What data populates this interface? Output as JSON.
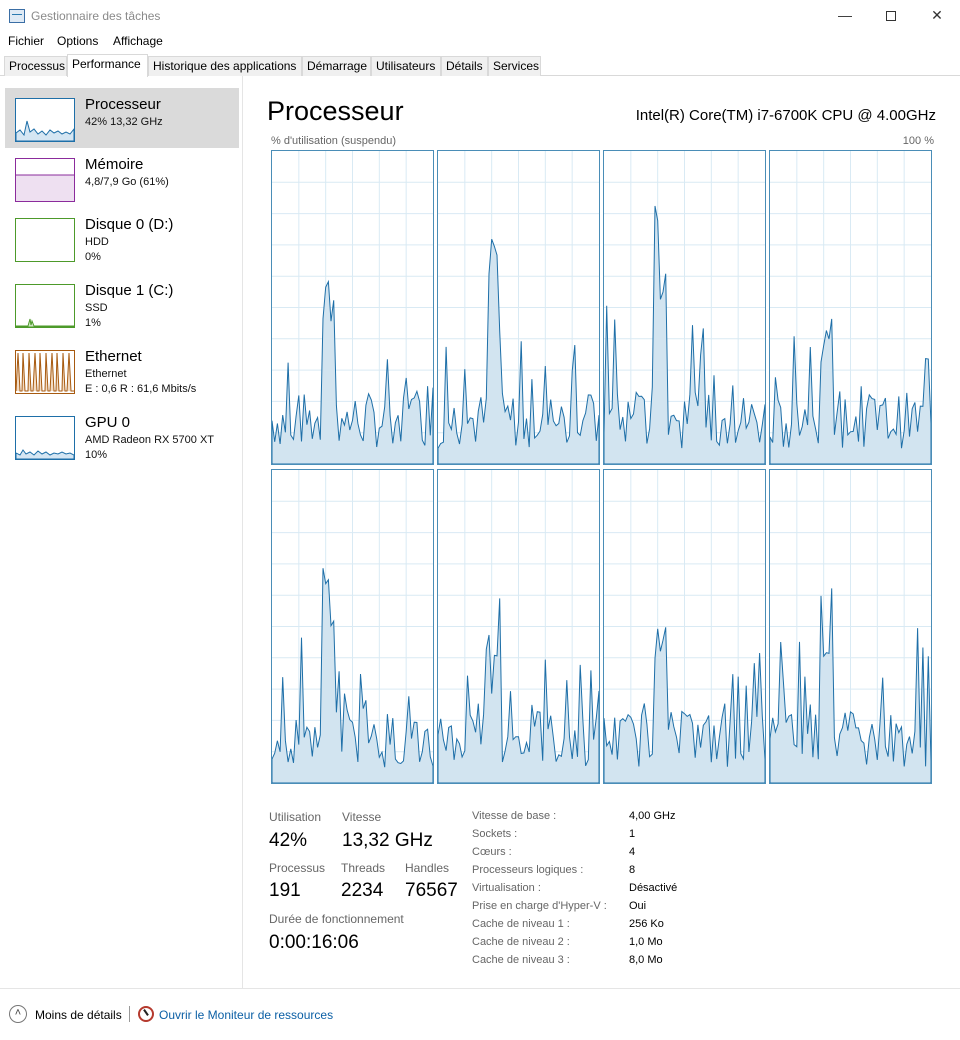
{
  "window": {
    "title": "Gestionnaire des tâches"
  },
  "menu": [
    "Fichier",
    "Options",
    "Affichage"
  ],
  "tabs": [
    "Processus",
    "Performance",
    "Historique des applications",
    "Démarrage",
    "Utilisateurs",
    "Détails",
    "Services"
  ],
  "active_tab": "Performance",
  "sidebar": {
    "items": [
      {
        "title": "Processeur",
        "sub1": "42% 13,32 GHz",
        "sub2": "",
        "sub3": "",
        "color": "#1e6fa8"
      },
      {
        "title": "Mémoire",
        "sub1": "4,8/7,9 Go (61%)",
        "sub2": "",
        "sub3": "",
        "color": "#8b2b9c"
      },
      {
        "title": "Disque 0 (D:)",
        "sub1": "HDD",
        "sub2": "0%",
        "sub3": "",
        "color": "#4d9a2a"
      },
      {
        "title": "Disque 1 (C:)",
        "sub1": "SSD",
        "sub2": "1%",
        "sub3": "",
        "color": "#4d9a2a"
      },
      {
        "title": "Ethernet",
        "sub1": "Ethernet",
        "sub2": "E : 0,6 R : 61,6 Mbits/s",
        "sub3": "",
        "color": "#a75a10"
      },
      {
        "title": "GPU 0",
        "sub1": "AMD Radeon RX 5700 XT",
        "sub2": "10%",
        "sub3": "",
        "color": "#1e6fa8"
      }
    ]
  },
  "main": {
    "title": "Processeur",
    "cpu_name": "Intel(R) Core(TM) i7-6700K CPU @ 4.00GHz",
    "graph_label": "% d'utilisation (suspendu)",
    "graph_max": "100 %",
    "stats": {
      "utilisation_label": "Utilisation",
      "utilisation": "42%",
      "vitesse_label": "Vitesse",
      "vitesse": "13,32 GHz",
      "processus_label": "Processus",
      "processus": "191",
      "threads_label": "Threads",
      "threads": "2234",
      "handles_label": "Handles",
      "handles": "76567",
      "uptime_label": "Durée de fonctionnement",
      "uptime": "0:00:16:06"
    },
    "specs": [
      {
        "label": "Vitesse de base :",
        "value": "4,00 GHz"
      },
      {
        "label": "Sockets :",
        "value": "1"
      },
      {
        "label": "Cœurs :",
        "value": "4"
      },
      {
        "label": "Processeurs logiques :",
        "value": "8"
      },
      {
        "label": "Virtualisation :",
        "value": "Désactivé"
      },
      {
        "label": "Prise en charge d'Hyper-V :",
        "value": "Oui"
      },
      {
        "label": "Cache de niveau 1 :",
        "value": "256 Ko"
      },
      {
        "label": "Cache de niveau 2 :",
        "value": "1,0 Mo"
      },
      {
        "label": "Cache de niveau 3 :",
        "value": "8,0 Mo"
      }
    ]
  },
  "footer": {
    "less_details": "Moins de détails",
    "resource_monitor": "Ouvrir le Moniteur de ressources"
  }
}
